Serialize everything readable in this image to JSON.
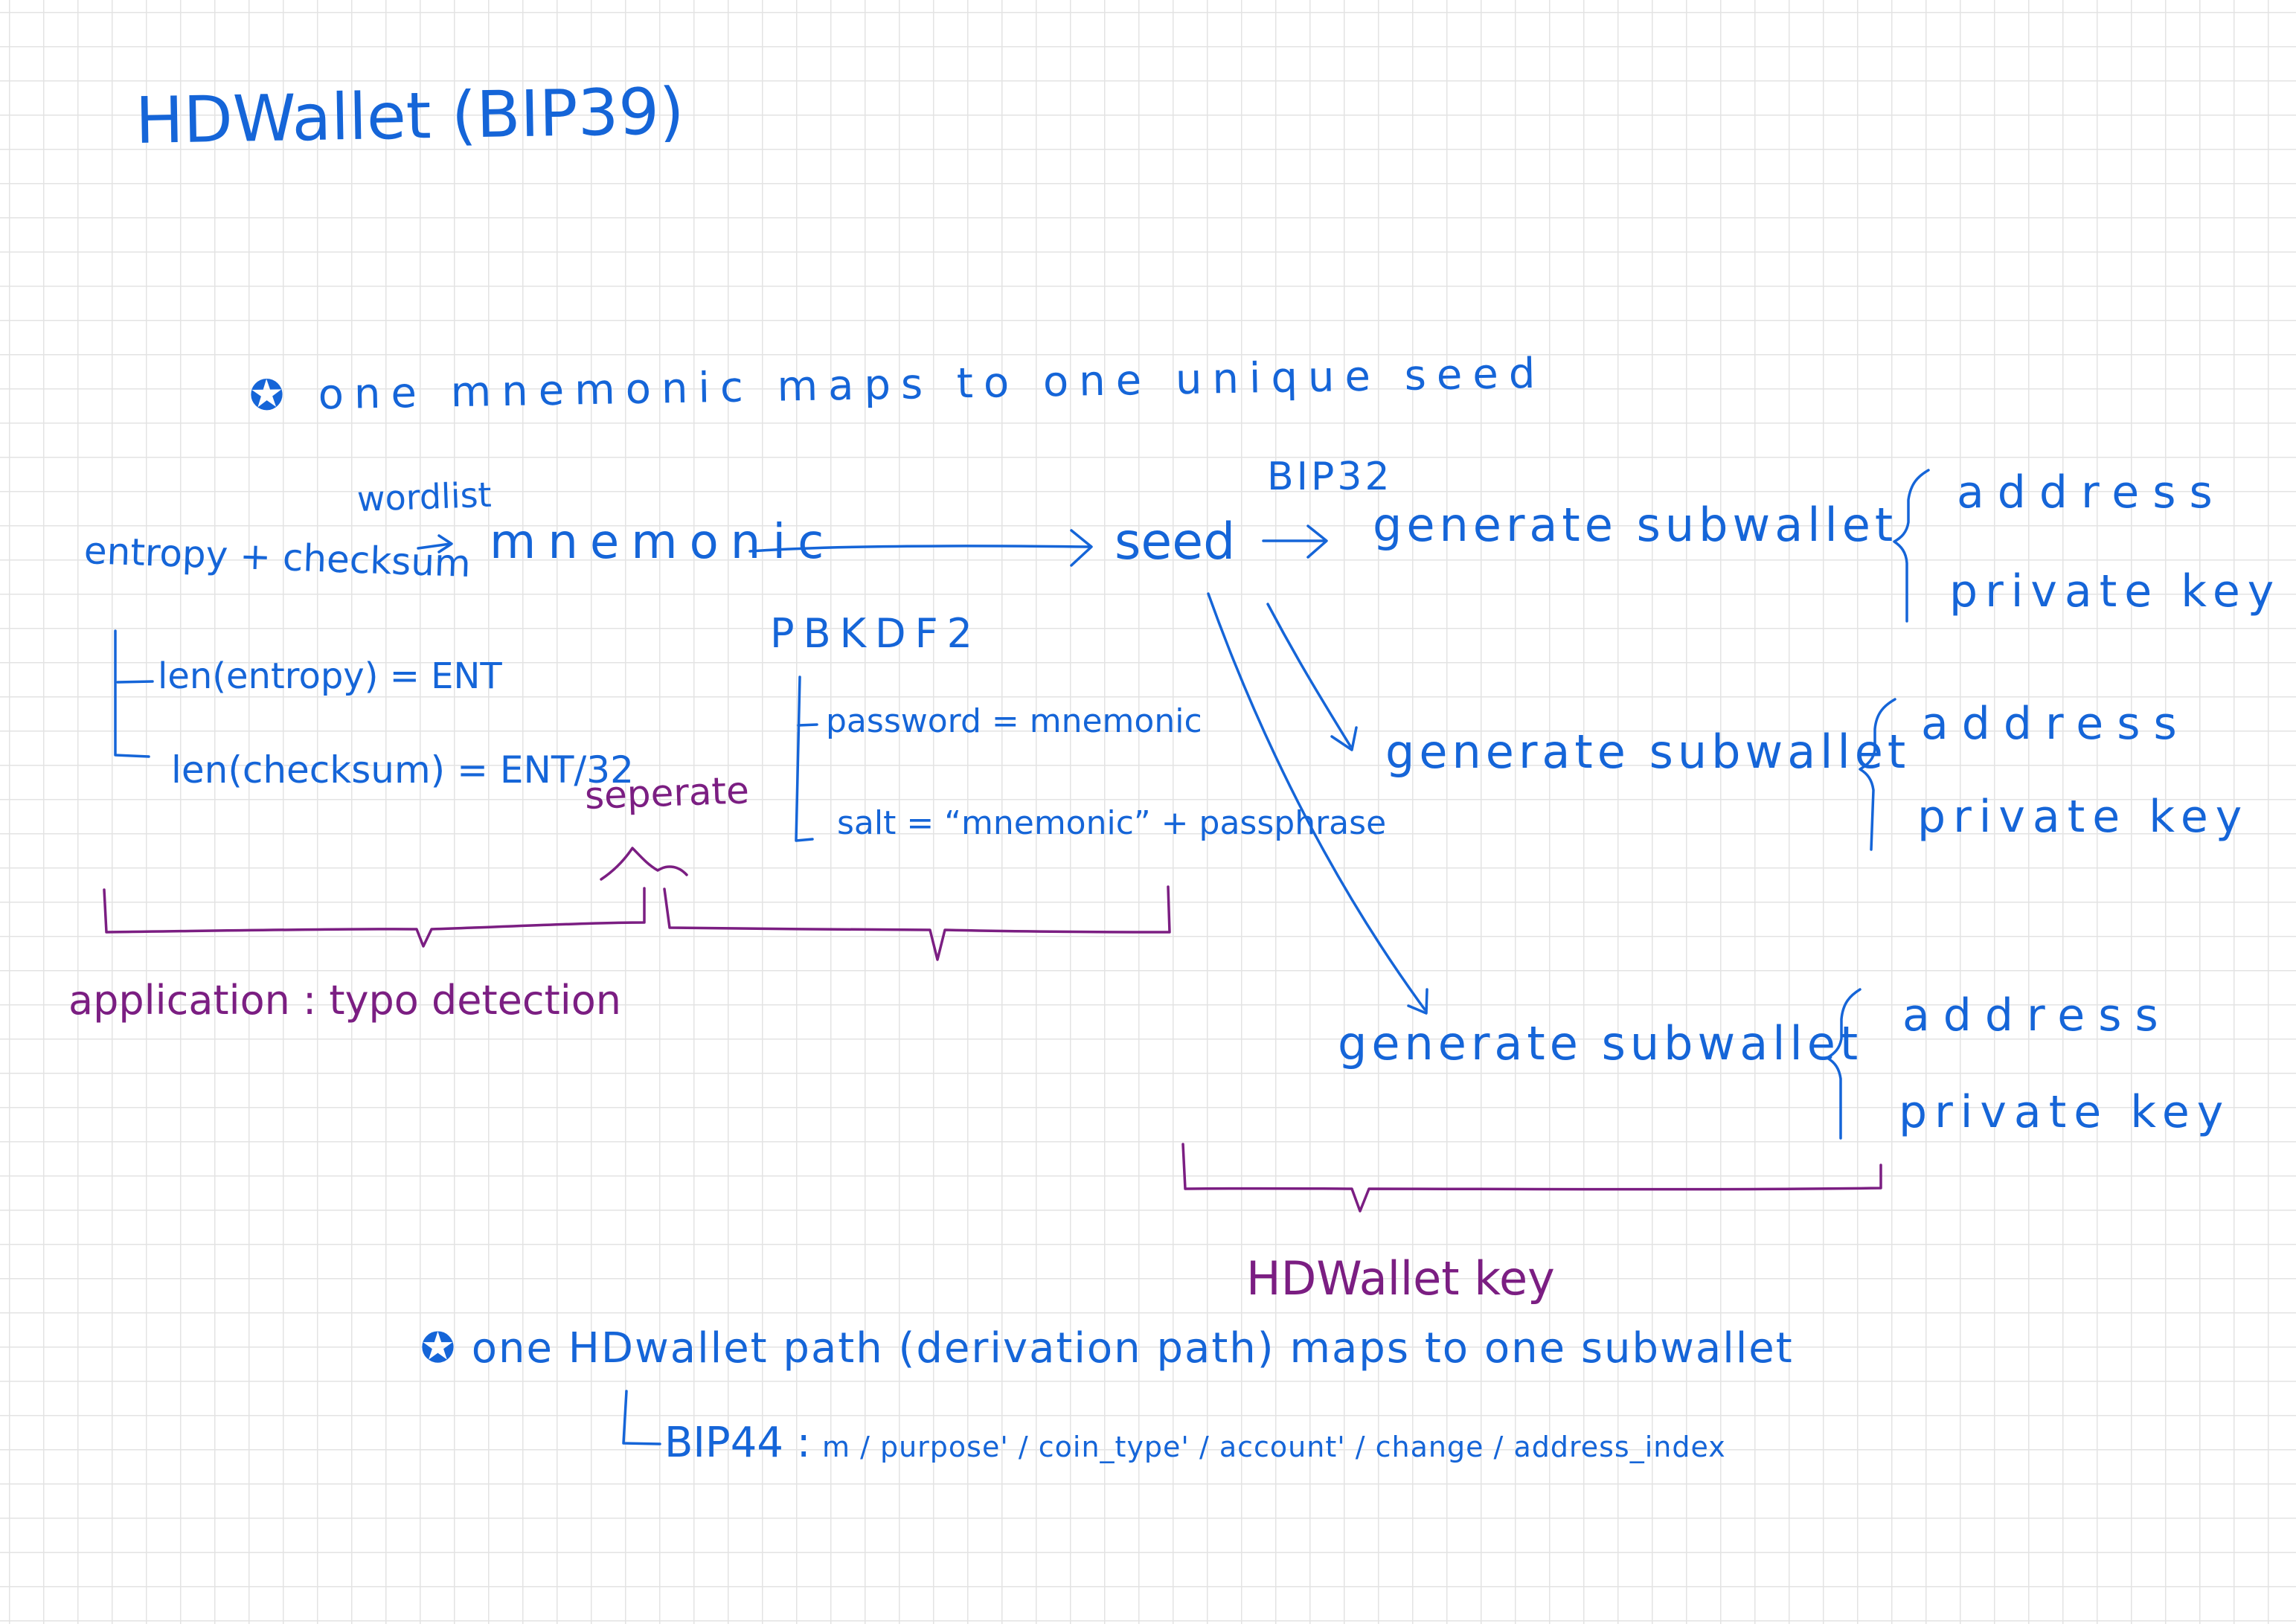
{
  "title": "HDWallet (BIP39)",
  "note_top": "✪ one mnemonic maps to one unique seed",
  "flow": {
    "entropy_checksum": "entropy + checksum",
    "arrow1_label": "wordlist",
    "mnemonic": "mnemonic",
    "seed": "seed",
    "arrow2_label": "BIP32",
    "kdf": "PBKDF2"
  },
  "entropy_notes": [
    "len(entropy) = ENT",
    "len(checksum) = ENT/32"
  ],
  "kdf_params": [
    "password = mnemonic",
    "salt = “mnemonic” + passphrase"
  ],
  "separate_label": "seperate",
  "application_label": "application : typo detection",
  "subwallets": [
    {
      "label": "generate subwallet",
      "address": "address",
      "private_key": "private key"
    },
    {
      "label": "generate subwallet",
      "address": "address",
      "private_key": "private key"
    },
    {
      "label": "generate subwallet",
      "address": "address",
      "private_key": "private key"
    }
  ],
  "hdwallet_key_label": "HDWallet key",
  "note_bottom": "✪ one HDwallet path (derivation path) maps to one subwallet",
  "bip44": {
    "label": "BIP44 :",
    "path": "m / purpose' / coin_type' / account' / change / address_index"
  },
  "colors": {
    "blue_ink": "#1565d8",
    "purple_ink": "#7b1e82",
    "grid": "#e3e3e3"
  }
}
